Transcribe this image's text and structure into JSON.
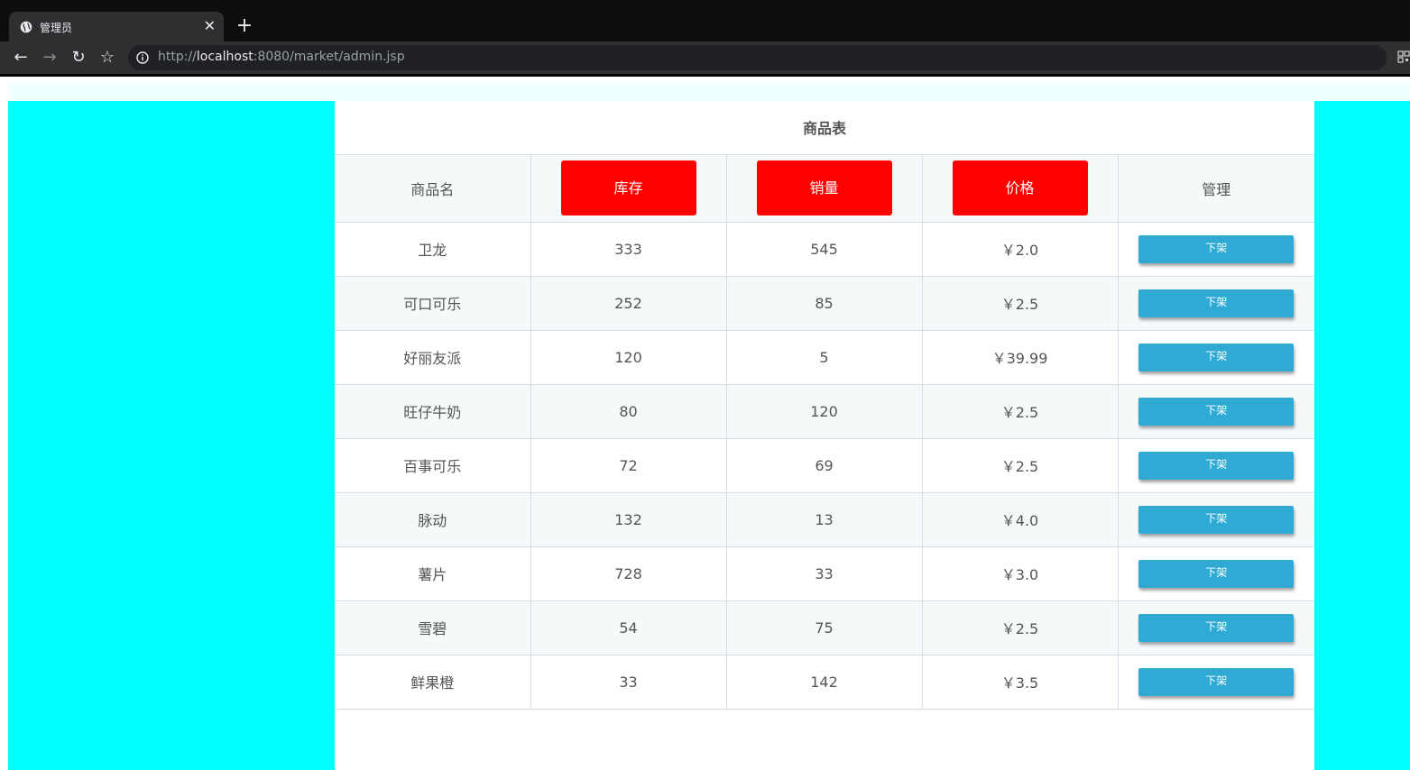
{
  "browser": {
    "tab_title": "管理员",
    "url_scheme": "http://",
    "url_host": "localhost",
    "url_rest": ":8080/market/admin.jsp"
  },
  "table": {
    "caption": "商品表",
    "headers": {
      "name": "商品名",
      "stock": "库存",
      "sales": "销量",
      "price": "价格",
      "manage": "管理"
    },
    "action_label": "下架",
    "rows": [
      {
        "name": "卫龙",
        "stock": "333",
        "sales": "545",
        "price": "￥2.0"
      },
      {
        "name": "可口可乐",
        "stock": "252",
        "sales": "85",
        "price": "￥2.5"
      },
      {
        "name": "好丽友派",
        "stock": "120",
        "sales": "5",
        "price": "￥39.99"
      },
      {
        "name": "旺仔牛奶",
        "stock": "80",
        "sales": "120",
        "price": "￥2.5"
      },
      {
        "name": "百事可乐",
        "stock": "72",
        "sales": "69",
        "price": "￥2.5"
      },
      {
        "name": "脉动",
        "stock": "132",
        "sales": "13",
        "price": "￥4.0"
      },
      {
        "name": "薯片",
        "stock": "728",
        "sales": "33",
        "price": "￥3.0"
      },
      {
        "name": "雪碧",
        "stock": "54",
        "sales": "75",
        "price": "￥2.5"
      },
      {
        "name": "鲜果橙",
        "stock": "33",
        "sales": "142",
        "price": "￥3.5"
      }
    ]
  },
  "colors": {
    "side_panels": "#00ffff",
    "sort_buttons": "#ff0000",
    "action_buttons": "#2eaad5"
  }
}
